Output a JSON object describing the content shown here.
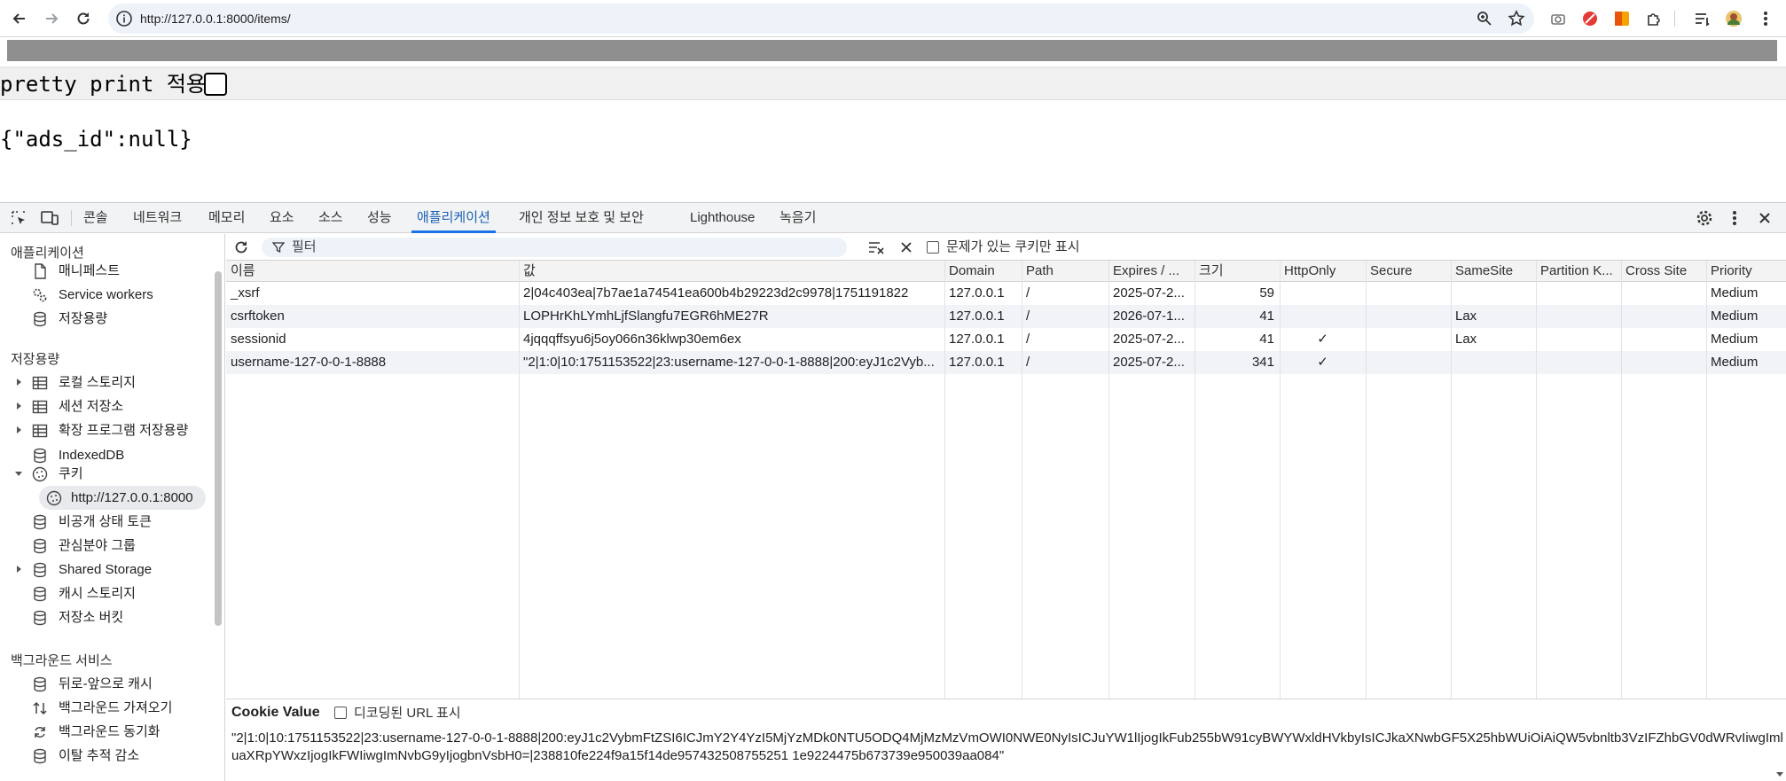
{
  "browser": {
    "url": "http://127.0.0.1:8000/items/"
  },
  "page": {
    "pretty_print_label": "pretty print 적용",
    "json_text": "{\"ads_id\":null}"
  },
  "devtools": {
    "tabs": [
      "콘솔",
      "네트워크",
      "메모리",
      "요소",
      "소스",
      "성능",
      "애플리케이션",
      "개인 정보 보호 및 보안",
      "Lighthouse",
      "녹음기"
    ],
    "active_tab": "애플리케이션",
    "sidebar": {
      "section_app": "애플리케이션",
      "app_items": [
        "매니페스트",
        "Service workers",
        "저장용량"
      ],
      "section_storage": "저장용량",
      "storage_items": [
        "로컬 스토리지",
        "세션 저장소",
        "확장 프로그램 저장용량",
        "IndexedDB",
        "쿠키",
        "http://127.0.0.1:8000",
        "비공개 상태 토큰",
        "관심분야 그룹",
        "Shared Storage",
        "캐시 스토리지",
        "저장소 버킷"
      ],
      "section_bg": "백그라운드 서비스",
      "bg_items": [
        "뒤로-앞으로 캐시",
        "백그라운드 가져오기",
        "백그라운드 동기화",
        "이탈 추적 감소"
      ]
    },
    "toolbar": {
      "filter_placeholder": "필터",
      "issue_only_label": "문제가 있는 쿠키만 표시"
    },
    "columns": [
      "이름",
      "값",
      "Domain",
      "Path",
      "Expires / ...",
      "크기",
      "HttpOnly",
      "Secure",
      "SameSite",
      "Partition K...",
      "Cross Site",
      "Priority"
    ],
    "rows": [
      {
        "name": "_xsrf",
        "value": "2|04c403ea|7b7ae1a74541ea600b4b29223d2c9978|1751191822",
        "domain": "127.0.0.1",
        "path": "/",
        "expires": "2025-07-2...",
        "size": "59",
        "httponly": "",
        "secure": "",
        "samesite": "",
        "partition": "",
        "crosssite": "",
        "priority": "Medium"
      },
      {
        "name": "csrftoken",
        "value": "LOPHrKhLYmhLjfSlangfu7EGR6hME27R",
        "domain": "127.0.0.1",
        "path": "/",
        "expires": "2026-07-1...",
        "size": "41",
        "httponly": "",
        "secure": "",
        "samesite": "Lax",
        "partition": "",
        "crosssite": "",
        "priority": "Medium"
      },
      {
        "name": "sessionid",
        "value": "4jqqqffsyu6j5oy066n36klwp30em6ex",
        "domain": "127.0.0.1",
        "path": "/",
        "expires": "2025-07-2...",
        "size": "41",
        "httponly": "✓",
        "secure": "",
        "samesite": "Lax",
        "partition": "",
        "crosssite": "",
        "priority": "Medium"
      },
      {
        "name": "username-127-0-0-1-8888",
        "value": "\"2|1:0|10:1751153522|23:username-127-0-0-1-8888|200:eyJ1c2Vyb...",
        "domain": "127.0.0.1",
        "path": "/",
        "expires": "2025-07-2...",
        "size": "341",
        "httponly": "✓",
        "secure": "",
        "samesite": "",
        "partition": "",
        "crosssite": "",
        "priority": "Medium"
      }
    ],
    "cookie_value": {
      "title": "Cookie Value",
      "decoded_label": "디코딩된 URL 표시",
      "text": "\"2|1:0|10:1751153522|23:username-127-0-0-1-8888|200:eyJ1c2VybmFtZSI6ICJmY2Y4YzI5MjYzMDk0NTU5ODQ4MjMzMzVmOWI0NWE0NyIsICJuYW1lIjogIkFub255bW91cyBWYWxldHVkbyIsICJkaXNwbGF5X25hbWUiOiAiQW5vbnltb3VzIFZhbGV0dWRvIiwgImluaXRpYWxzIjogIkFWIiwgImNvbG9yIjogbnVsbH0=|238810fe224f9a15f14de957432508755251 1e9224475b673739e950039aa084\""
    }
  }
}
